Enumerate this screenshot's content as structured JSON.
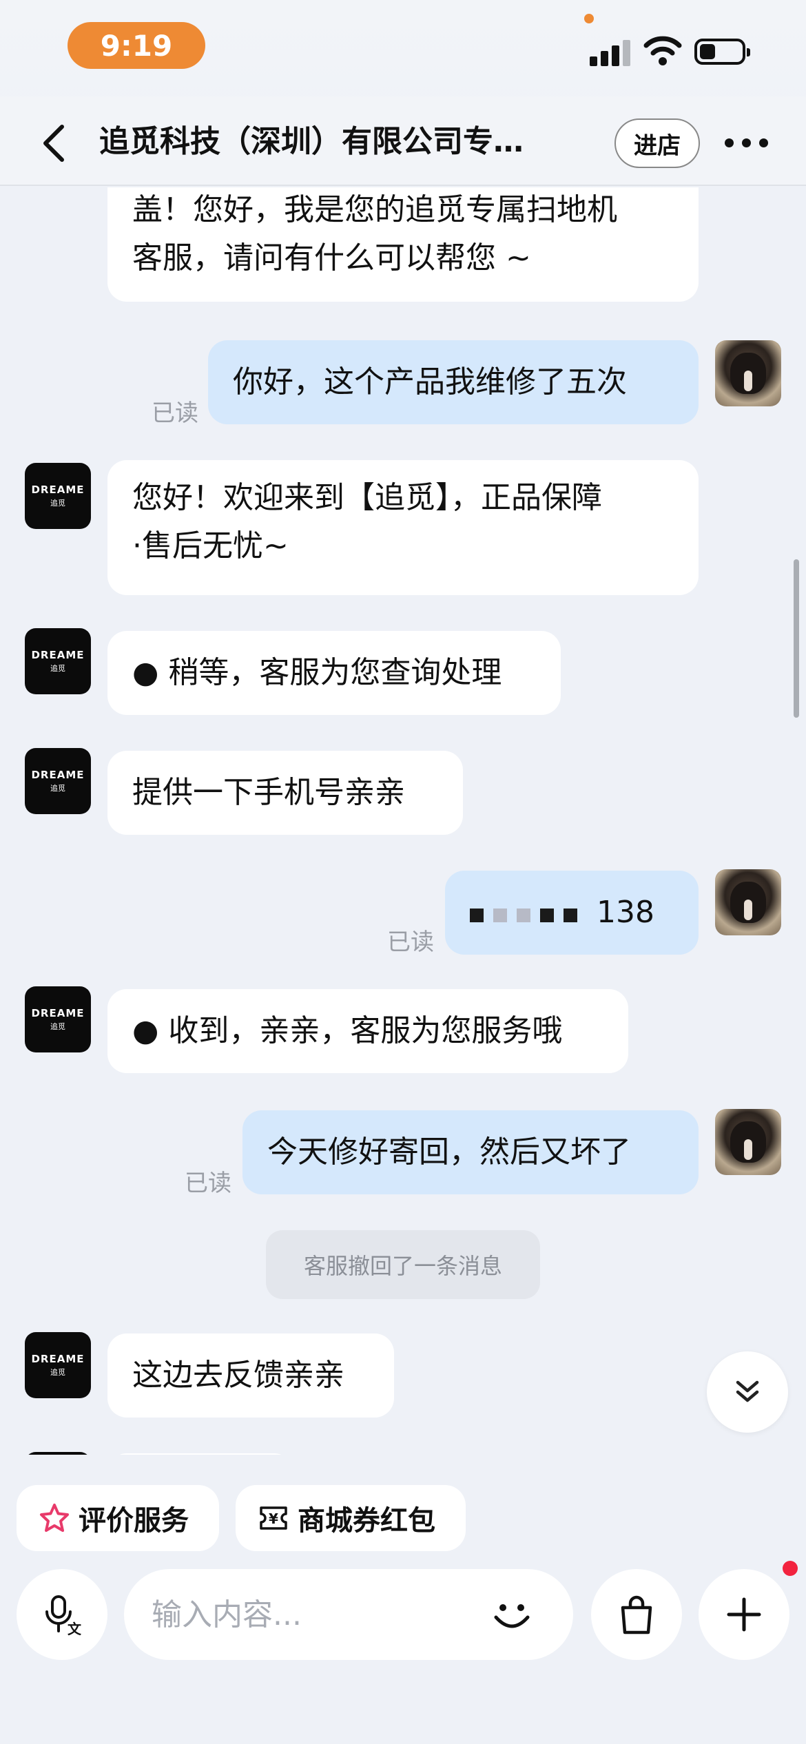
{
  "status_bar": {
    "time": "9:19"
  },
  "header": {
    "title": "追觅科技（深圳）有限公司专…",
    "store_button": "进店"
  },
  "shop_avatar": {
    "brand": "DREAME",
    "brand_cn": "追觅"
  },
  "messages": [
    {
      "from": "shop",
      "text_line1": "盖！您好，我是您的追觅专属扫地机",
      "text_line2": "客服，请问有什么可以帮您 ~"
    },
    {
      "from": "user",
      "text": "你好，这个产品我维修了五次",
      "status": "已读"
    },
    {
      "from": "shop",
      "text_line1": "您好！欢迎来到【追觅】，正品保障",
      "text_line2": "·售后无忧~"
    },
    {
      "from": "shop",
      "text": "● 稍等，客服为您查询处理"
    },
    {
      "from": "shop",
      "text": "提供一下手机号亲亲"
    },
    {
      "from": "user",
      "text": "138",
      "status": "已读"
    },
    {
      "from": "shop",
      "text": "● 收到，亲亲，客服为您服务哦"
    },
    {
      "from": "user",
      "text": "今天修好寄回，然后又坏了",
      "status": "已读"
    },
    {
      "from": "shop",
      "text": "这边去反馈亲亲"
    }
  ],
  "system_message": "客服撤回了一条消息",
  "bottom": {
    "chip_rate": "评价服务",
    "chip_coupon": "商城券红包",
    "input_placeholder": "输入内容..."
  }
}
